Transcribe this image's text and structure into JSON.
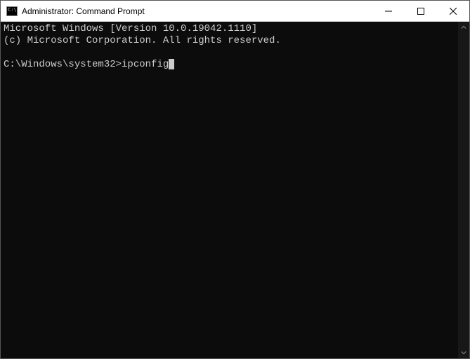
{
  "window": {
    "title": "Administrator: Command Prompt"
  },
  "terminal": {
    "line1": "Microsoft Windows [Version 10.0.19042.1110]",
    "line2": "(c) Microsoft Corporation. All rights reserved.",
    "blank": "",
    "prompt": "C:\\Windows\\system32>",
    "command": "ipconfig"
  }
}
